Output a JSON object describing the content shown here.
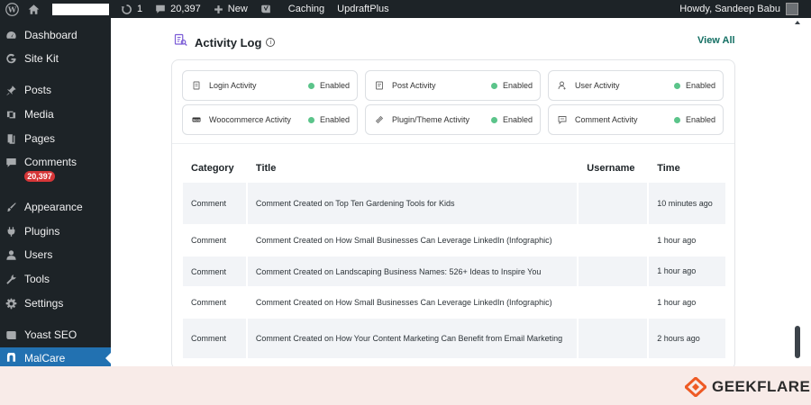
{
  "adminbar": {
    "updates_count": "1",
    "comments_count": "20,397",
    "new_label": "New",
    "caching_label": "Caching",
    "updraft_label": "UpdraftPlus",
    "greeting": "Howdy, Sandeep Babu"
  },
  "sidebar": {
    "items": [
      {
        "label": "Dashboard",
        "icon": "dashboard-icon"
      },
      {
        "label": "Site Kit",
        "icon": "sitekit-icon"
      },
      {
        "label": "Posts",
        "icon": "pin-icon"
      },
      {
        "label": "Media",
        "icon": "media-icon"
      },
      {
        "label": "Pages",
        "icon": "pages-icon"
      },
      {
        "label": "Comments",
        "icon": "comment-icon",
        "badge": "20,397"
      },
      {
        "label": "Appearance",
        "icon": "brush-icon"
      },
      {
        "label": "Plugins",
        "icon": "plugin-icon"
      },
      {
        "label": "Users",
        "icon": "users-icon"
      },
      {
        "label": "Tools",
        "icon": "wrench-icon"
      },
      {
        "label": "Settings",
        "icon": "settings-icon"
      },
      {
        "label": "Yoast SEO",
        "icon": "yoast-icon"
      },
      {
        "label": "MalCare",
        "icon": "malcare-icon",
        "active": true
      }
    ]
  },
  "activity": {
    "title": "Activity Log",
    "view_all": "View All",
    "filters": [
      {
        "label": "Login Activity",
        "status": "Enabled",
        "icon": "login-icon"
      },
      {
        "label": "Post Activity",
        "status": "Enabled",
        "icon": "post-icon"
      },
      {
        "label": "User Activity",
        "status": "Enabled",
        "icon": "user-icon"
      },
      {
        "label": "Woocommerce Activity",
        "status": "Enabled",
        "icon": "woo-icon"
      },
      {
        "label": "Plugin/Theme Activity",
        "status": "Enabled",
        "icon": "plugin-theme-icon"
      },
      {
        "label": "Comment Activity",
        "status": "Enabled",
        "icon": "comment-activity-icon"
      }
    ],
    "status_color": "#5bc48a",
    "table": {
      "headers": [
        "Category",
        "Title",
        "Username",
        "Time"
      ],
      "rows": [
        {
          "category": "Comment",
          "title": "Comment Created on Top Ten Gardening Tools for Kids",
          "username": "",
          "time": "10 minutes ago"
        },
        {
          "category": "Comment",
          "title": "Comment Created on How Small Businesses Can Leverage LinkedIn (Infographic)",
          "username": "",
          "time": "1 hour ago"
        },
        {
          "category": "Comment",
          "title": "Comment Created on Landscaping Business Names: 526+ Ideas to Inspire You",
          "username": "",
          "time": "1 hour ago"
        },
        {
          "category": "Comment",
          "title": "Comment Created on How Small Businesses Can Leverage LinkedIn (Infographic)",
          "username": "",
          "time": "1 hour ago"
        },
        {
          "category": "Comment",
          "title": "Comment Created on How Your Content Marketing Can Benefit from Email Marketing",
          "username": "",
          "time": "2 hours ago"
        }
      ]
    }
  },
  "footer": {
    "brand": "GEEKFLARE",
    "brand_color": "#ee5a24"
  },
  "colors": {
    "sidebar_bg": "#1d2327",
    "active_bg": "#2271b1",
    "accent_link": "#136f63",
    "badge": "#d63638"
  }
}
